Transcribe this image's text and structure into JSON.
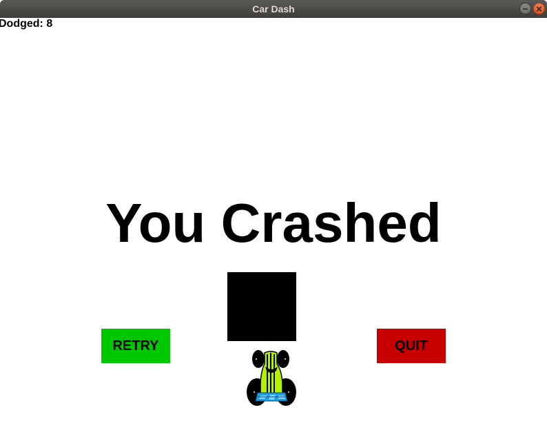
{
  "window": {
    "title": "Car Dash"
  },
  "hud": {
    "score_label": "Dodged: 8"
  },
  "game_over": {
    "message": "You Crashed"
  },
  "buttons": {
    "retry_label": "RETRY",
    "quit_label": "QUIT"
  },
  "colors": {
    "retry": "#00c800",
    "quit": "#c80000",
    "obstacle": "#000000",
    "car_body": "#b4f000",
    "car_accent": "#1fa0e0"
  },
  "icons": {
    "minimize": "minimize-icon",
    "close": "close-icon",
    "player_car": "player-car-icon"
  }
}
